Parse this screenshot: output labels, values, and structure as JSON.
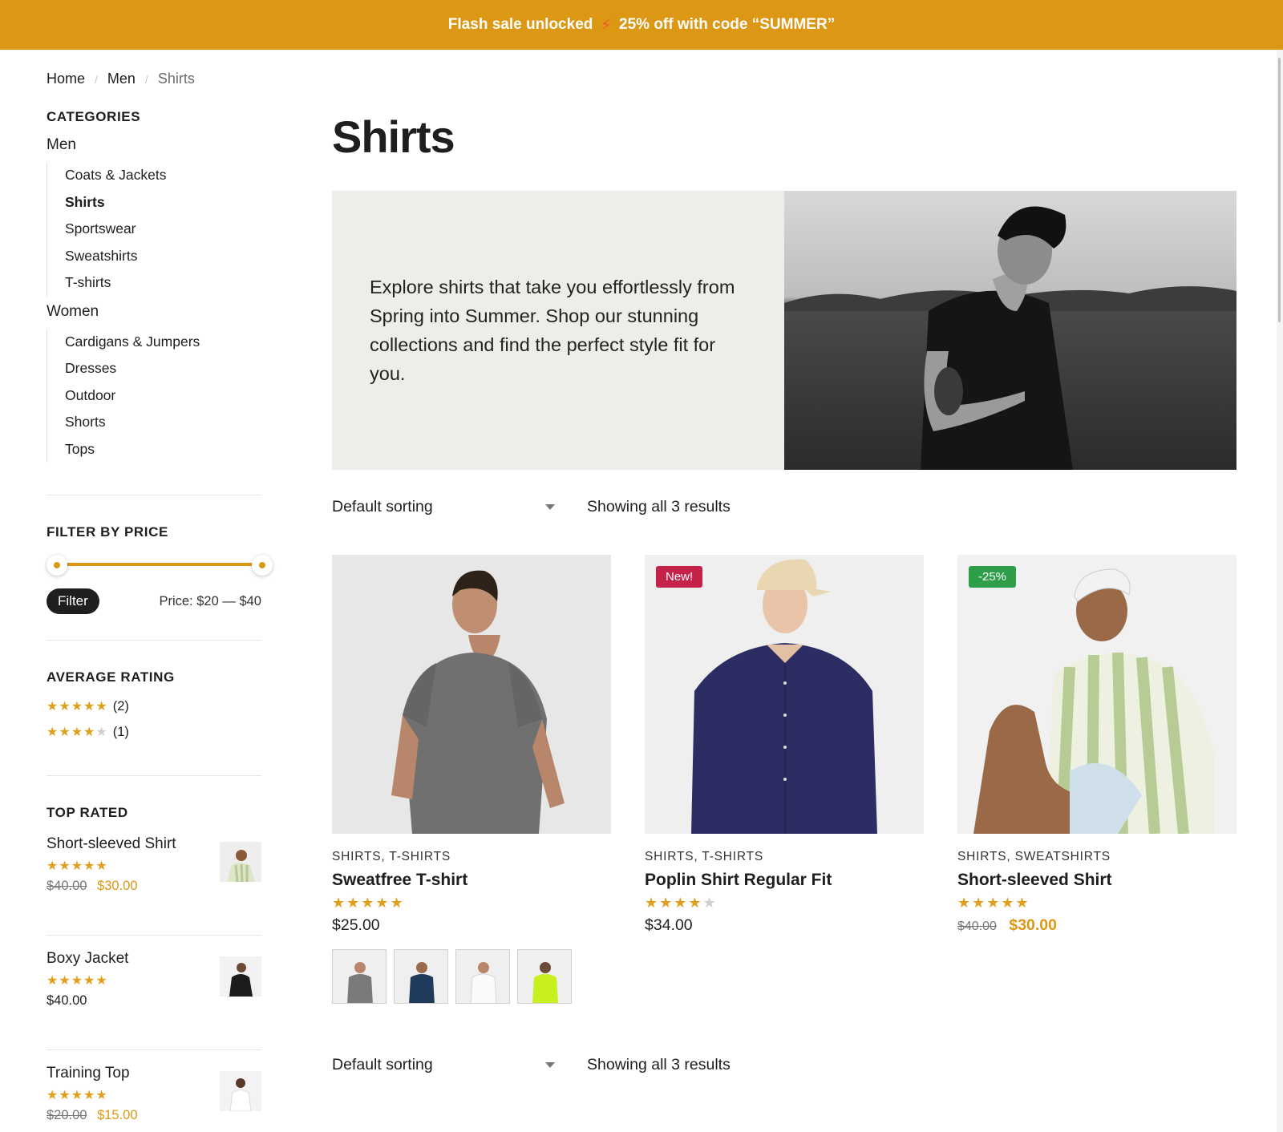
{
  "banner": {
    "text_left": "Flash sale unlocked",
    "icon": "lightning-icon",
    "text_right": "25% off with code “SUMMER”"
  },
  "breadcrumb": [
    "Home",
    "Men",
    "Shirts"
  ],
  "sidebar": {
    "categories_title": "CATEGORIES",
    "groups": [
      {
        "label": "Men",
        "items": [
          "Coats & Jackets",
          "Shirts",
          "Sportswear",
          "Sweatshirts",
          "T-shirts"
        ],
        "active": "Shirts"
      },
      {
        "label": "Women",
        "items": [
          "Cardigans & Jumpers",
          "Dresses",
          "Outdoor",
          "Shorts",
          "Tops"
        ]
      }
    ],
    "price_filter": {
      "title": "FILTER BY PRICE",
      "range_min": 20,
      "range_max": 40,
      "button": "Filter",
      "label": "Price: $20 — $40"
    },
    "rating": {
      "title": "AVERAGE RATING",
      "rows": [
        {
          "stars": 5,
          "count": "(2)"
        },
        {
          "stars": 4,
          "count": "(1)"
        }
      ]
    },
    "top_rated": {
      "title": "TOP RATED",
      "items": [
        {
          "name": "Short-sleeved Shirt",
          "stars": 5,
          "old_price": "$40.00",
          "price": "$30.00"
        },
        {
          "name": "Boxy Jacket",
          "stars": 5,
          "price": "$40.00"
        },
        {
          "name": "Training Top",
          "stars": 5,
          "old_price": "$20.00",
          "price": "$15.00"
        }
      ]
    }
  },
  "main": {
    "title": "Shirts",
    "hero_text": "Explore shirts that take you effortlessly from Spring into Summer. Shop our stunning collections and find the perfect style fit for you.",
    "sorting": "Default sorting",
    "result_count": "Showing all 3 results",
    "products": [
      {
        "categories": "SHIRTS, T-SHIRTS",
        "name": "Sweatfree T-shirt",
        "stars": 5,
        "price": "$25.00",
        "swatch_colors": [
          "#7a7a7a",
          "#1f3a5a",
          "#f2f2f2",
          "#c8f01e"
        ]
      },
      {
        "categories": "SHIRTS, T-SHIRTS",
        "name": "Poplin Shirt Regular Fit",
        "stars": 4,
        "price": "$34.00",
        "badge": "New!"
      },
      {
        "categories": "SHIRTS, SWEATSHIRTS",
        "name": "Short-sleeved Shirt",
        "stars": 5,
        "old_price": "$40.00",
        "price": "$30.00",
        "badge": "-25%"
      }
    ]
  },
  "colors": {
    "accent": "#dc9814",
    "badge_new": "#c5224a",
    "badge_sale": "#2e9e48"
  }
}
